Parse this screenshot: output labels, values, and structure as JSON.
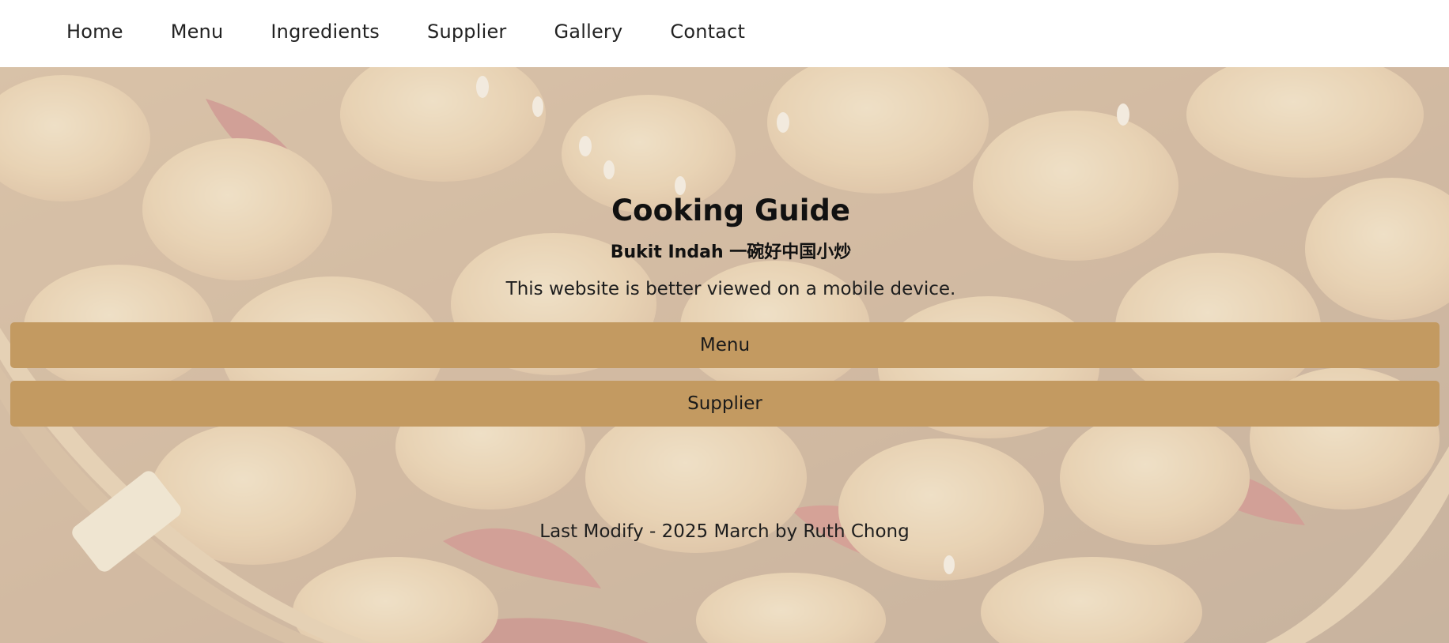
{
  "nav": {
    "items": [
      {
        "label": "Home"
      },
      {
        "label": "Menu"
      },
      {
        "label": "Ingredients"
      },
      {
        "label": "Supplier"
      },
      {
        "label": "Gallery"
      },
      {
        "label": "Contact"
      }
    ]
  },
  "hero": {
    "title": "Cooking Guide",
    "subtitle": "Bukit Indah 一碗好中国小炒",
    "notice": "This website is better viewed on a mobile device."
  },
  "buttons": {
    "menu_label": "Menu",
    "supplier_label": "Supplier"
  },
  "footer": {
    "text": "Last Modify - 2025 March by Ruth Chong"
  },
  "colors": {
    "button": "#c39a61",
    "nav_background": "#ffffff"
  }
}
